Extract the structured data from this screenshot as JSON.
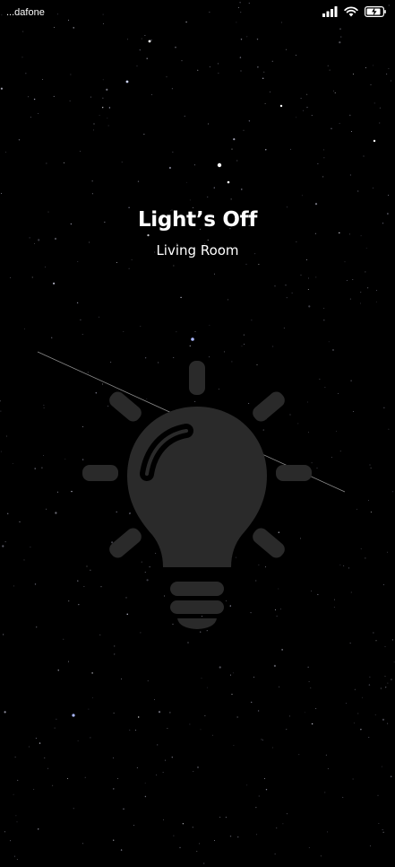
{
  "status_bar": {
    "carrier": "...dafone",
    "icons": [
      "signal-icon",
      "wifi-icon",
      "battery-charging-icon"
    ]
  },
  "light": {
    "title": "Light’s Off",
    "room": "Living Room",
    "state": "off",
    "icon": "lightbulb-icon"
  },
  "colors": {
    "background": "#000000",
    "bulb": "#2a2a2a",
    "text": "#ffffff"
  }
}
